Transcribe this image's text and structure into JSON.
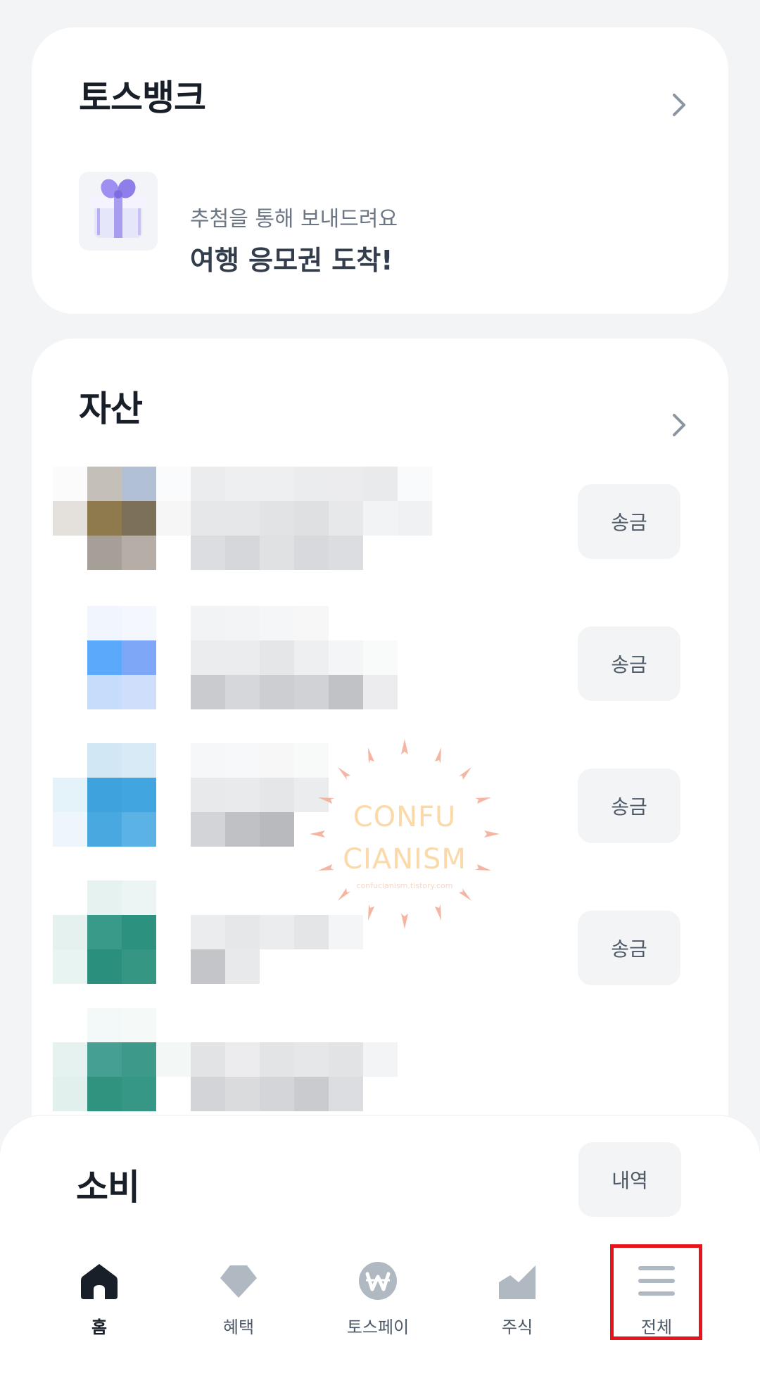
{
  "bank_card": {
    "title": "토스뱅크",
    "promo_subtitle": "추첨을 통해 보내드려요",
    "promo_title": "여행 응모권 도착!"
  },
  "asset_card": {
    "title": "자산",
    "send_label": "송금"
  },
  "watermark": {
    "line1": "CONFU",
    "line2": "CIANISM",
    "url": "confucianism.tistory.com"
  },
  "spending_card": {
    "title": "소비",
    "history_label": "내역"
  },
  "tabs": [
    {
      "label": "홈",
      "icon": "home-icon",
      "active": true
    },
    {
      "label": "혜택",
      "icon": "gem-icon",
      "active": false
    },
    {
      "label": "토스페이",
      "icon": "won-coin-icon",
      "active": false
    },
    {
      "label": "주식",
      "icon": "stock-chart-icon",
      "active": false
    },
    {
      "label": "전체",
      "icon": "menu-icon",
      "active": false
    }
  ],
  "colors": {
    "background": "#f2f4f6",
    "card": "#ffffff",
    "title_text": "#191f28",
    "secondary_text": "#6b7684",
    "button_bg": "#f2f4f6",
    "icon_gray": "#b0b8c1",
    "highlight_box": "#e8141b"
  }
}
